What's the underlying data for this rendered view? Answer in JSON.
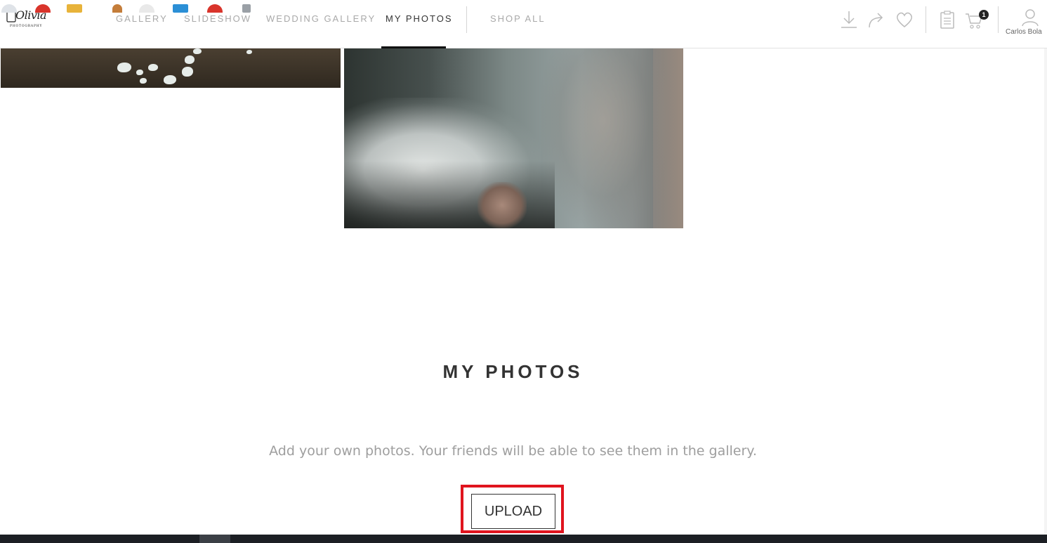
{
  "logo": {
    "script": "Olivia",
    "subtitle": "PHOTOGRAPHY"
  },
  "nav": {
    "items": [
      {
        "label": "GALLERY",
        "active": false
      },
      {
        "label": "SLIDESHOW",
        "active": false
      },
      {
        "label": "WEDDING GALLERY",
        "active": false
      },
      {
        "label": "MY PHOTOS",
        "active": true
      },
      {
        "label": "SHOP ALL",
        "active": false
      }
    ]
  },
  "header_icons": {
    "download": "download-icon",
    "share": "share-icon",
    "favorite": "heart-icon",
    "orders": "clipboard-icon",
    "cart": "cart-icon",
    "cart_count": "1",
    "user": "user-icon",
    "user_name": "Carlos Bola"
  },
  "section": {
    "title": "MY PHOTOS",
    "description": "Add your own photos. Your friends will be able to see them in the gallery.",
    "upload_label": "UPLOAD"
  },
  "colors": {
    "highlight": "#e0141e",
    "active_nav": "#333333",
    "inactive_nav": "#a9a9a9",
    "description": "#9e9e9e"
  }
}
